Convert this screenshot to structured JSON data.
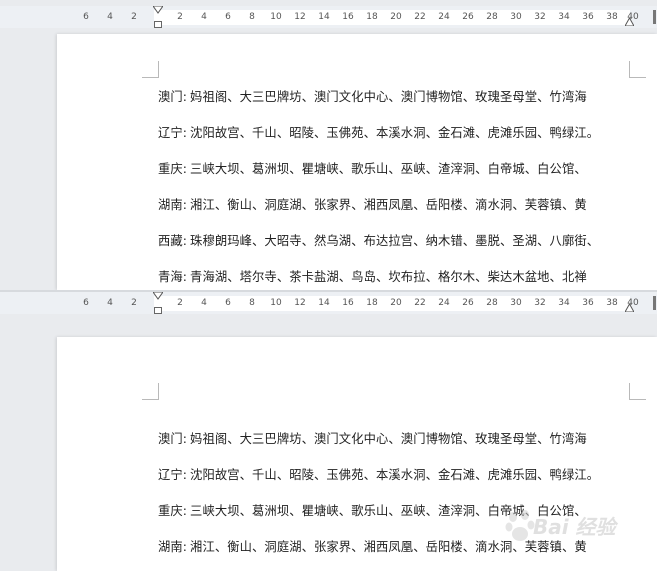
{
  "ruler": {
    "labels": [
      "6",
      "4",
      "2",
      "2",
      "4",
      "6",
      "8",
      "10",
      "12",
      "14",
      "16",
      "18",
      "20",
      "22",
      "24",
      "26",
      "28",
      "30",
      "32",
      "34",
      "36",
      "38",
      "40"
    ]
  },
  "lines": [
    {
      "label": "澳门:",
      "text": "妈祖阁、大三巴牌坊、澳门文化中心、澳门博物馆、玫瑰圣母堂、竹湾海"
    },
    {
      "label": "辽宁:",
      "text": "沈阳故宫、千山、昭陵、玉佛苑、本溪水洞、金石滩、虎滩乐园、鸭绿江。"
    },
    {
      "label": "重庆:",
      "text": "三峡大坝、葛洲坝、瞿塘峡、歌乐山、巫峡、渣滓洞、白帝城、白公馆、"
    },
    {
      "label": "湖南:",
      "text": "湘江、衡山、洞庭湖、张家界、湘西凤凰、岳阳楼、滴水洞、芙蓉镇、黄"
    },
    {
      "label": "西藏:",
      "text": "珠穆朗玛峰、大昭寺、然乌湖、布达拉宫、纳木错、墨脱、圣湖、八廓街、"
    },
    {
      "label": "青海:",
      "text": "青海湖、塔尔寺、茶卡盐湖、鸟岛、坎布拉、格尔木、柴达木盆地、北禅"
    }
  ],
  "lines2": [
    {
      "label": "澳门:",
      "text": "妈祖阁、大三巴牌坊、澳门文化中心、澳门博物馆、玫瑰圣母堂、竹湾海"
    },
    {
      "label": "辽宁:",
      "text": "沈阳故宫、千山、昭陵、玉佛苑、本溪水洞、金石滩、虎滩乐园、鸭绿江。"
    },
    {
      "label": "重庆:",
      "text": "三峡大坝、葛洲坝、瞿塘峡、歌乐山、巫峡、渣滓洞、白帝城、白公馆、"
    },
    {
      "label": "湖南:",
      "text": "湘江、衡山、洞庭湖、张家界、湘西凤凰、岳阳楼、滴水洞、芙蓉镇、黄"
    }
  ],
  "watermark": {
    "text": "Bai 经验"
  }
}
